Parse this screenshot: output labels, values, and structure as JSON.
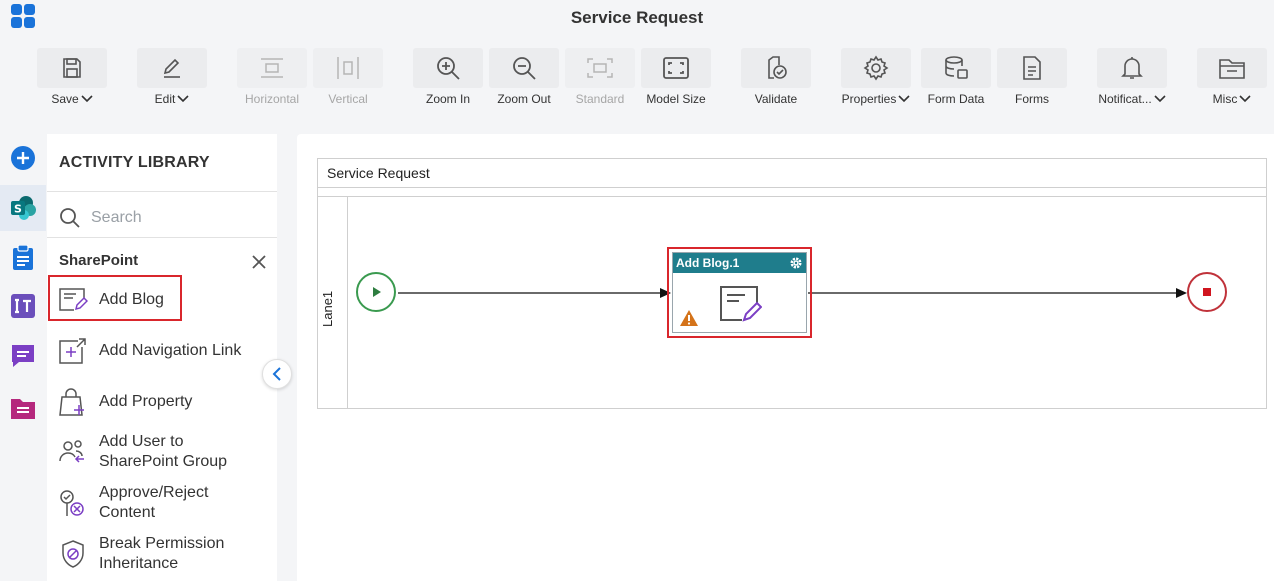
{
  "app": {
    "title": "Service Request"
  },
  "toolbar": {
    "save": "Save",
    "edit": "Edit",
    "horizontal": "Horizontal",
    "vertical": "Vertical",
    "zoom_in": "Zoom In",
    "zoom_out": "Zoom Out",
    "standard": "Standard",
    "model_size": "Model Size",
    "validate": "Validate",
    "properties": "Properties",
    "form_data": "Form Data",
    "forms": "Forms",
    "notifications": "Notificat...",
    "misc": "Misc"
  },
  "library": {
    "title": "ACTIVITY LIBRARY",
    "search_placeholder": "Search",
    "category": "SharePoint",
    "items": [
      {
        "label": "Add Blog",
        "icon": "add-blog-icon"
      },
      {
        "label": "Add Navigation Link",
        "icon": "add-navigation-link-icon"
      },
      {
        "label": "Add Property",
        "icon": "add-property-icon"
      },
      {
        "label": "Add User to SharePoint Group",
        "icon": "add-user-group-icon"
      },
      {
        "label": "Approve/Reject Content",
        "icon": "approve-reject-icon"
      },
      {
        "label": "Break Permission Inheritance",
        "icon": "break-permission-icon"
      }
    ]
  },
  "canvas": {
    "pool_title": "Service Request",
    "lane_label": "Lane1",
    "task_title": "Add Blog.1"
  },
  "colors": {
    "accent_blue": "#1a73d9",
    "task_header": "#1f7d8c",
    "selection_red": "#d9262c",
    "start_green": "#3a9a4f",
    "end_red": "#c0323a"
  }
}
